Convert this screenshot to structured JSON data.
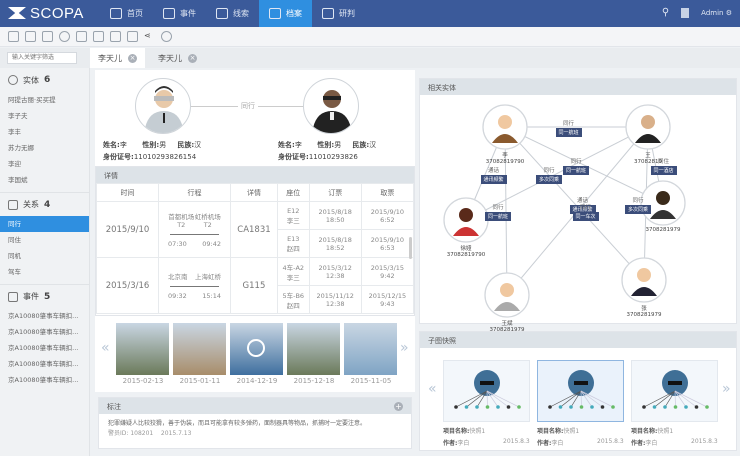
{
  "app": {
    "brand": "SCOPA",
    "nav": [
      {
        "label": "首页",
        "icon": "home-icon"
      },
      {
        "label": "事件",
        "icon": "event-icon"
      },
      {
        "label": "线索",
        "icon": "user-icon"
      },
      {
        "label": "档案",
        "icon": "archive-icon",
        "active": true
      },
      {
        "label": "研判",
        "icon": "analysis-icon"
      }
    ],
    "user": "Admin"
  },
  "tabs": {
    "search_placeholder": "输入关键字筛选",
    "items": [
      "李天儿",
      "李天儿"
    ]
  },
  "sidebar": {
    "sections": [
      {
        "title": "实体",
        "count": "6",
        "items": [
          "阿提古丽·买买提",
          "李子夫",
          "李丰",
          "苏力无娜",
          "李迎",
          "李国斌"
        ]
      },
      {
        "title": "关系",
        "count": "4",
        "items": [
          "同行",
          "同住",
          "同机",
          "驾车"
        ],
        "active": 0
      },
      {
        "title": "事件",
        "count": "5",
        "items": [
          "京A10080肇事车辆扣...",
          "京A10080肇事车辆扣...",
          "京A10080肇事车辆扣...",
          "京A10080肇事车辆扣...",
          "京A10080肇事车辆扣..."
        ]
      }
    ]
  },
  "relation": {
    "label": "同行",
    "left": {
      "name_label": "姓名:",
      "name": "李",
      "gender_label": "性别:",
      "gender": "男",
      "ethnic_label": "民族:",
      "ethnic": "汉",
      "id_label": "身份证号:",
      "id": "11010293826154"
    },
    "right": {
      "name_label": "姓名:",
      "name": "李",
      "gender_label": "性别:",
      "gender": "男",
      "ethnic_label": "民族:",
      "ethnic": "汉",
      "id_label": "身份证号:",
      "id": "11010293826"
    }
  },
  "details": {
    "title": "详情",
    "columns": [
      "时间",
      "行程",
      "详情",
      "座位",
      "订票",
      "取票"
    ],
    "rows": [
      {
        "date": "2015/9/10",
        "from": "首都机场T2",
        "to": "虹桥机场T2",
        "dep": "07:30",
        "arr": "09:42",
        "detail": "CA1831",
        "subs": [
          {
            "seat": "E12",
            "name": "李三",
            "book": "2015/8/18",
            "book_t": "18:50",
            "take": "2015/9/10",
            "take_t": "6:52"
          },
          {
            "seat": "E13",
            "name": "赵四",
            "book": "2015/8/18",
            "book_t": "18:52",
            "take": "2015/9/10",
            "take_t": "6:53"
          }
        ]
      },
      {
        "date": "2015/3/16",
        "from": "北京南",
        "to": "上海虹桥",
        "dep": "09:32",
        "arr": "15:14",
        "detail": "G115",
        "subs": [
          {
            "seat": "4车-A2",
            "name": "李三",
            "book": "2015/3/12",
            "book_t": "12:38",
            "take": "2015/3/15",
            "take_t": "9:42"
          },
          {
            "seat": "5车-B6",
            "name": "赵四",
            "book": "2015/11/12",
            "book_t": "12:38",
            "take": "2015/12/15",
            "take_t": "9:43"
          }
        ]
      }
    ]
  },
  "media": {
    "items": [
      {
        "date": "2015-02-13",
        "kind": "car"
      },
      {
        "date": "2015-01-11",
        "kind": "house"
      },
      {
        "date": "2014-12-19",
        "kind": "video"
      },
      {
        "date": "2015-12-18",
        "kind": "car"
      },
      {
        "date": "2015-11-05",
        "kind": "building"
      }
    ]
  },
  "notes": {
    "title": "标注",
    "text": "犯罪嫌疑人比较狡猾，善于伪装，而且可能拿有较多弹药，面制器具等物品，抓捕时一定要注意。",
    "author_label": "警员ID:",
    "author": "108201",
    "date": "2015.7.13"
  },
  "graph": {
    "title": "相关实体",
    "nodes": [
      {
        "name": "李",
        "id": "37082819790"
      },
      {
        "name": "王",
        "id": "37082819"
      },
      {
        "name": "徐娅",
        "id": "37082819790"
      },
      {
        "name": "",
        "id": "3708281979"
      },
      {
        "name": "王斌",
        "id": "3708281979"
      },
      {
        "name": "张",
        "id": "3708281979"
      }
    ],
    "edges": [
      {
        "label": "同行",
        "tag": "同一航班"
      },
      {
        "label": "同住",
        "tag": "同一酒店"
      },
      {
        "label": "同行",
        "tag": "同一航班"
      },
      {
        "label": "通话",
        "tag": "通讯频繁"
      },
      {
        "label": "同行",
        "tag": "多次同乘"
      },
      {
        "label": "通话",
        "tag": "通讯频繁"
      },
      {
        "label": "同行",
        "tag": "同一航班"
      },
      {
        "label": "同行",
        "tag": "同一车次"
      },
      {
        "label": "同行",
        "tag": "多次同乘"
      }
    ]
  },
  "snapshots": {
    "title": "子图快照",
    "items": [
      {
        "name_label": "项目名称:",
        "name": "快照1",
        "author_label": "作者:",
        "author": "李白",
        "date": "2015.8.3"
      },
      {
        "name_label": "项目名称:",
        "name": "快照1",
        "author_label": "作者:",
        "author": "李白",
        "date": "2015.8.3"
      },
      {
        "name_label": "项目名称:",
        "name": "快照1",
        "author_label": "作者:",
        "author": "李白",
        "date": "2015.8.3"
      }
    ]
  }
}
